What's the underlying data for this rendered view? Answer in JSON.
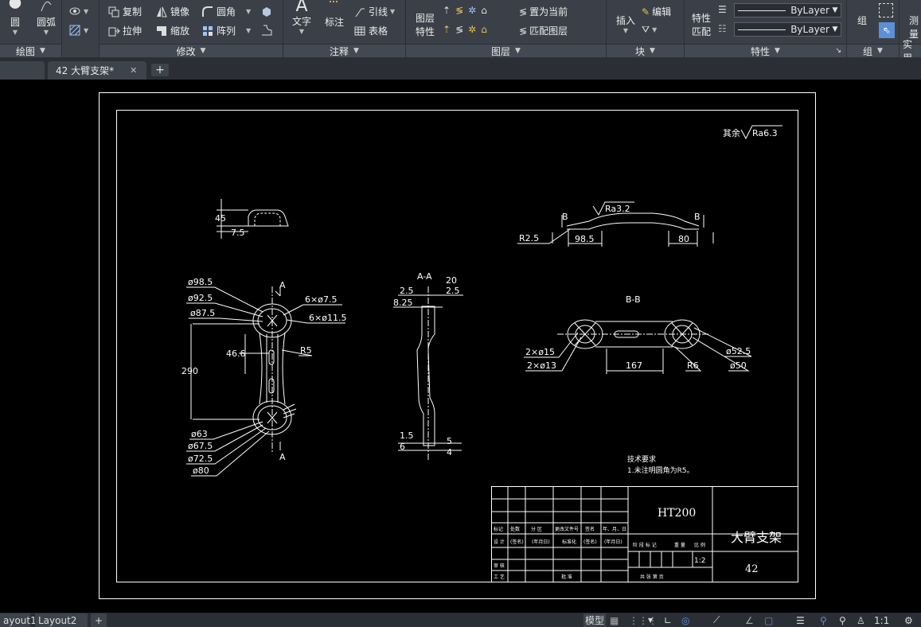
{
  "ribbon": {
    "draw_panel": {
      "title": "绘图",
      "circle_label": "圆",
      "arc_label": "圆弧"
    },
    "modify_panel": {
      "title": "修改",
      "copy_label": "复制",
      "mirror_label": "镜像",
      "fillet_label": "圆角",
      "stretch_label": "拉伸",
      "scale_label": "缩放",
      "array_label": "阵列"
    },
    "annotation_panel": {
      "title": "注释",
      "text_label": "文字",
      "dim_label": "标注",
      "leader_label": "引线",
      "table_label": "表格"
    },
    "layers_panel": {
      "title": "图层",
      "layer_props_label_1": "图层",
      "layer_props_label_2": "特性",
      "set_current_label": "置为当前",
      "match_layer_label": "匹配图层"
    },
    "block_panel": {
      "title": "块",
      "insert_label": "插入",
      "edit_label": "编辑"
    },
    "properties_panel": {
      "title": "特性",
      "match_label_1": "特性",
      "match_label_2": "匹配",
      "linetype_value": "ByLayer",
      "lineweight_value": "ByLayer"
    },
    "groups_panel": {
      "title": "组",
      "group_label": "组"
    },
    "utilities_panel": {
      "title": "实用",
      "measure_label": "测量"
    }
  },
  "tabs": {
    "active_doc": "42 大臂支架*",
    "plus": "+"
  },
  "drawing": {
    "roughness_note_prefix": "其余",
    "roughness_note_value": "Ra6.3",
    "top_view": {
      "dim_45": "45",
      "dim_7_5": "7.5"
    },
    "main_view": {
      "d98_5": "ø98.5",
      "d92_5": "ø92.5",
      "d87_5": "ø87.5",
      "holes_6x7_5": "6×ø7.5",
      "holes_6x11_5": "6×ø11.5",
      "r5": "R5",
      "dim_46_6": "46.6",
      "dim_290": "290",
      "d63": "ø63",
      "d67_5": "ø67.5",
      "d72_5": "ø72.5",
      "d80": "ø80",
      "section_a_top": "A",
      "section_a_bottom": "A"
    },
    "section_aa": {
      "title": "A-A",
      "dim_2_5_l": "2.5",
      "dim_20": "20",
      "dim_2_5_r": "2.5",
      "dim_8_25": "8.25",
      "dim_1_5": "1.5",
      "dim_6": "6",
      "dim_5": "5",
      "dim_4": "4"
    },
    "side_view": {
      "ra": "Ra3.2",
      "r2_5": "R2.5",
      "dim_98_5": "98.5",
      "dim_80": "80",
      "b_left": "B",
      "b_right": "B"
    },
    "section_bb": {
      "title": "B-B",
      "holes_2x15": "2×ø15",
      "holes_2x13": "2×ø13",
      "dim_167": "167",
      "r6": "R6",
      "d52_5": "ø52.5",
      "d50": "ø50"
    },
    "tech_req": {
      "title": "技术要求",
      "line1": "1.未注明圆角为R5。"
    },
    "title_block": {
      "material": "HT200",
      "part_name": "大臂支架",
      "drawing_no": "42",
      "scale": "1:2",
      "hdr_mark": "标记",
      "hdr_count": "处数",
      "hdr_zone": "分 区",
      "hdr_docno": "更改文件号",
      "hdr_sign": "签名",
      "hdr_date": "年、月、日",
      "design": "设 计",
      "sign_paren": "(签名)",
      "date_paren": "(年月日)",
      "standardize": "标准化",
      "stage": "阶 段 标 记",
      "weight": "重 量",
      "ratio": "比 例",
      "review": "审 核",
      "process": "工 艺",
      "approve": "批 准",
      "sheets": "共   张   第   页"
    }
  },
  "status": {
    "layout1": "ayout1",
    "layout2": "Layout2",
    "plus": "+",
    "model": "模型",
    "scale": "1:1"
  },
  "colors": {
    "ribbon_bg": "#3b4048",
    "canvas_bg": "#000000",
    "cad_line": "#ffffff",
    "active_tool": "#5b8fd6"
  }
}
